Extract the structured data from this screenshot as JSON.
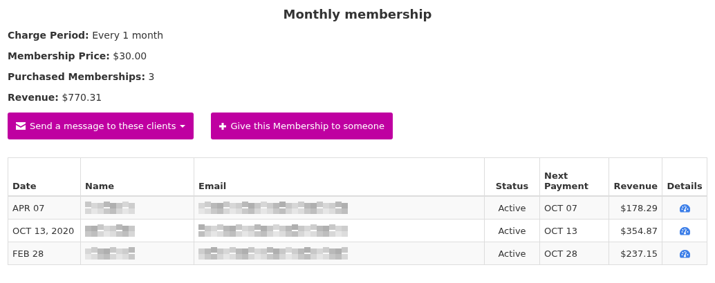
{
  "title": "Monthly membership",
  "details": [
    "**Charge Period:** Every 1 month",
    "**Membership Price:** $30.00",
    "**Purchased Memberships:** 3",
    "**Revenue:** $770.31"
  ],
  "buttons": [
    {
      "kind": "dropdown",
      "label": "Send a message to these clients"
    },
    {
      "kind": "add",
      "label": "Give this Membership to someone"
    }
  ],
  "table": {
    "columns": [
      {
        "label": "Date"
      },
      {
        "label": "Name"
      },
      {
        "label": "Email"
      },
      {
        "label": "Status"
      },
      {
        "label": "Next Payment"
      },
      {
        "label": "Revenue"
      },
      {
        "label": "Details"
      }
    ],
    "rows": [
      {
        "date": "APR 07",
        "name_redacted": true,
        "email_redacted": true,
        "status": "Active",
        "next_payment": "OCT 07",
        "revenue": "$178.29"
      },
      {
        "date": "OCT 13, 2020",
        "name_redacted": true,
        "email_redacted": true,
        "status": "Active",
        "next_payment": "OCT 13",
        "revenue": "$354.87"
      },
      {
        "date": "FEB 28",
        "name_redacted": true,
        "email_redacted": true,
        "status": "Active",
        "next_payment": "OCT 28",
        "revenue": "$237.15"
      }
    ]
  }
}
